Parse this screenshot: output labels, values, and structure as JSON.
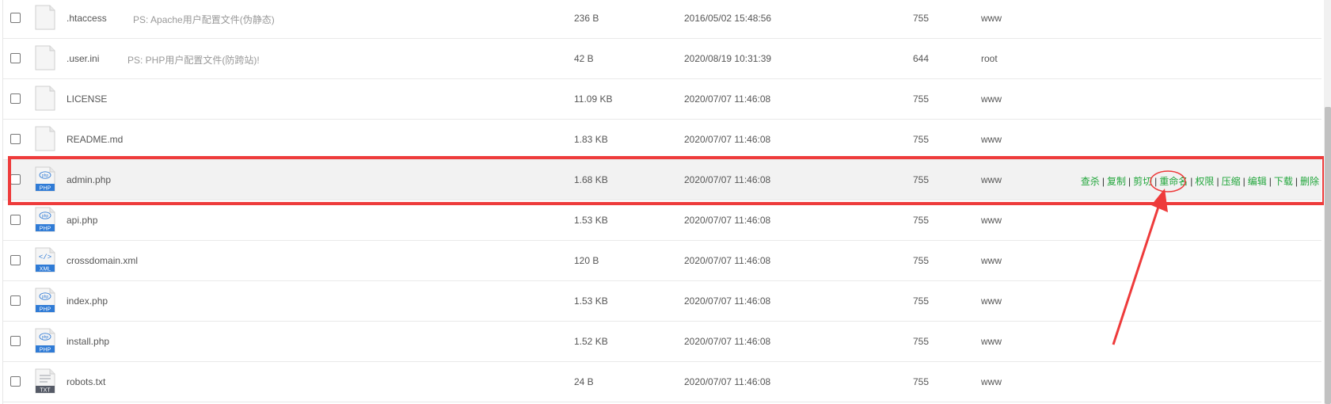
{
  "files": [
    {
      "name": ".htaccess",
      "note": "PS: Apache用户配置文件(伪静态)",
      "size": "236 B",
      "mtime": "2016/05/02 15:48:56",
      "perm": "755",
      "owner": "www",
      "icon": "generic-file-icon"
    },
    {
      "name": ".user.ini",
      "note": "PS: PHP用户配置文件(防跨站)!",
      "size": "42 B",
      "mtime": "2020/08/19 10:31:39",
      "perm": "644",
      "owner": "root",
      "icon": "generic-file-icon"
    },
    {
      "name": "LICENSE",
      "note": "",
      "size": "11.09 KB",
      "mtime": "2020/07/07 11:46:08",
      "perm": "755",
      "owner": "www",
      "icon": "generic-file-icon"
    },
    {
      "name": "README.md",
      "note": "",
      "size": "1.83 KB",
      "mtime": "2020/07/07 11:46:08",
      "perm": "755",
      "owner": "www",
      "icon": "generic-file-icon"
    },
    {
      "name": "admin.php",
      "note": "",
      "size": "1.68 KB",
      "mtime": "2020/07/07 11:46:08",
      "perm": "755",
      "owner": "www",
      "icon": "php-file-icon",
      "hovered": true
    },
    {
      "name": "api.php",
      "note": "",
      "size": "1.53 KB",
      "mtime": "2020/07/07 11:46:08",
      "perm": "755",
      "owner": "www",
      "icon": "php-file-icon"
    },
    {
      "name": "crossdomain.xml",
      "note": "",
      "size": "120 B",
      "mtime": "2020/07/07 11:46:08",
      "perm": "755",
      "owner": "www",
      "icon": "xml-file-icon"
    },
    {
      "name": "index.php",
      "note": "",
      "size": "1.53 KB",
      "mtime": "2020/07/07 11:46:08",
      "perm": "755",
      "owner": "www",
      "icon": "php-file-icon"
    },
    {
      "name": "install.php",
      "note": "",
      "size": "1.52 KB",
      "mtime": "2020/07/07 11:46:08",
      "perm": "755",
      "owner": "www",
      "icon": "php-file-icon"
    },
    {
      "name": "robots.txt",
      "note": "",
      "size": "24 B",
      "mtime": "2020/07/07 11:46:08",
      "perm": "755",
      "owner": "www",
      "icon": "txt-file-icon"
    }
  ],
  "row_actions": [
    "查杀",
    "复制",
    "剪切",
    "重命名",
    "权限",
    "压缩",
    "编辑",
    "下载",
    "删除"
  ],
  "action_separator": "|",
  "icon_labels": {
    "php": "PHP",
    "xml": "XML",
    "txt": "TXT"
  },
  "colors": {
    "action_link": "#20a53a",
    "annotation": "#ee3b3b",
    "hover_row": "#f2f2f2"
  }
}
